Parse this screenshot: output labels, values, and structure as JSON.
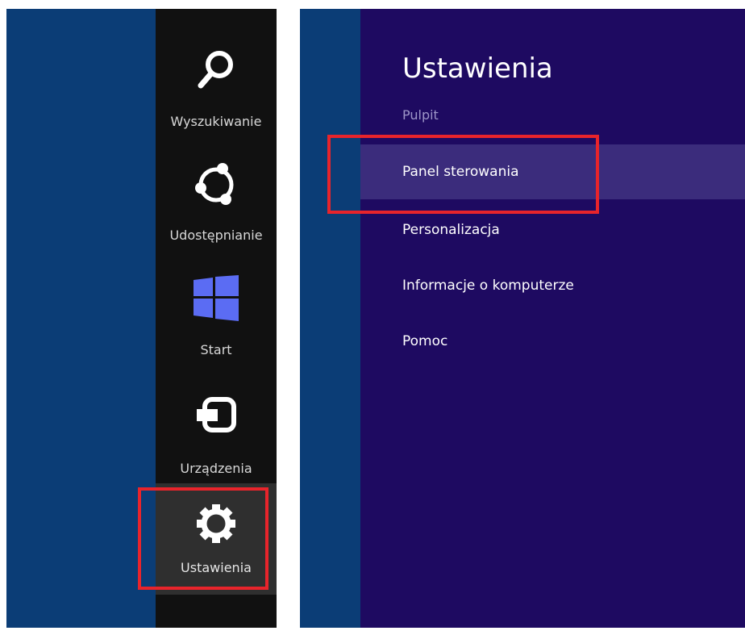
{
  "charms": {
    "search": {
      "label": "Wyszukiwanie",
      "icon": "search-icon"
    },
    "share": {
      "label": "Udostępnianie",
      "icon": "share-icon"
    },
    "start": {
      "label": "Start",
      "icon": "windows-logo-icon"
    },
    "devices": {
      "label": "Urządzenia",
      "icon": "devices-icon"
    },
    "settings": {
      "label": "Ustawienia",
      "icon": "gear-icon"
    }
  },
  "settings_pane": {
    "title": "Ustawienia",
    "subtitle": "Pulpit",
    "items": [
      {
        "label": "Panel sterowania"
      },
      {
        "label": "Personalizacja"
      },
      {
        "label": "Informacje o komputerze"
      },
      {
        "label": "Pomoc"
      }
    ]
  },
  "colors": {
    "desktop": "#0b3d76",
    "charms_bar": "#111111",
    "settings_pane": "#1e0a61",
    "selected_item": "#3b2c7c",
    "windows_logo": "#5b6cf3",
    "highlight": "#e8242b"
  }
}
